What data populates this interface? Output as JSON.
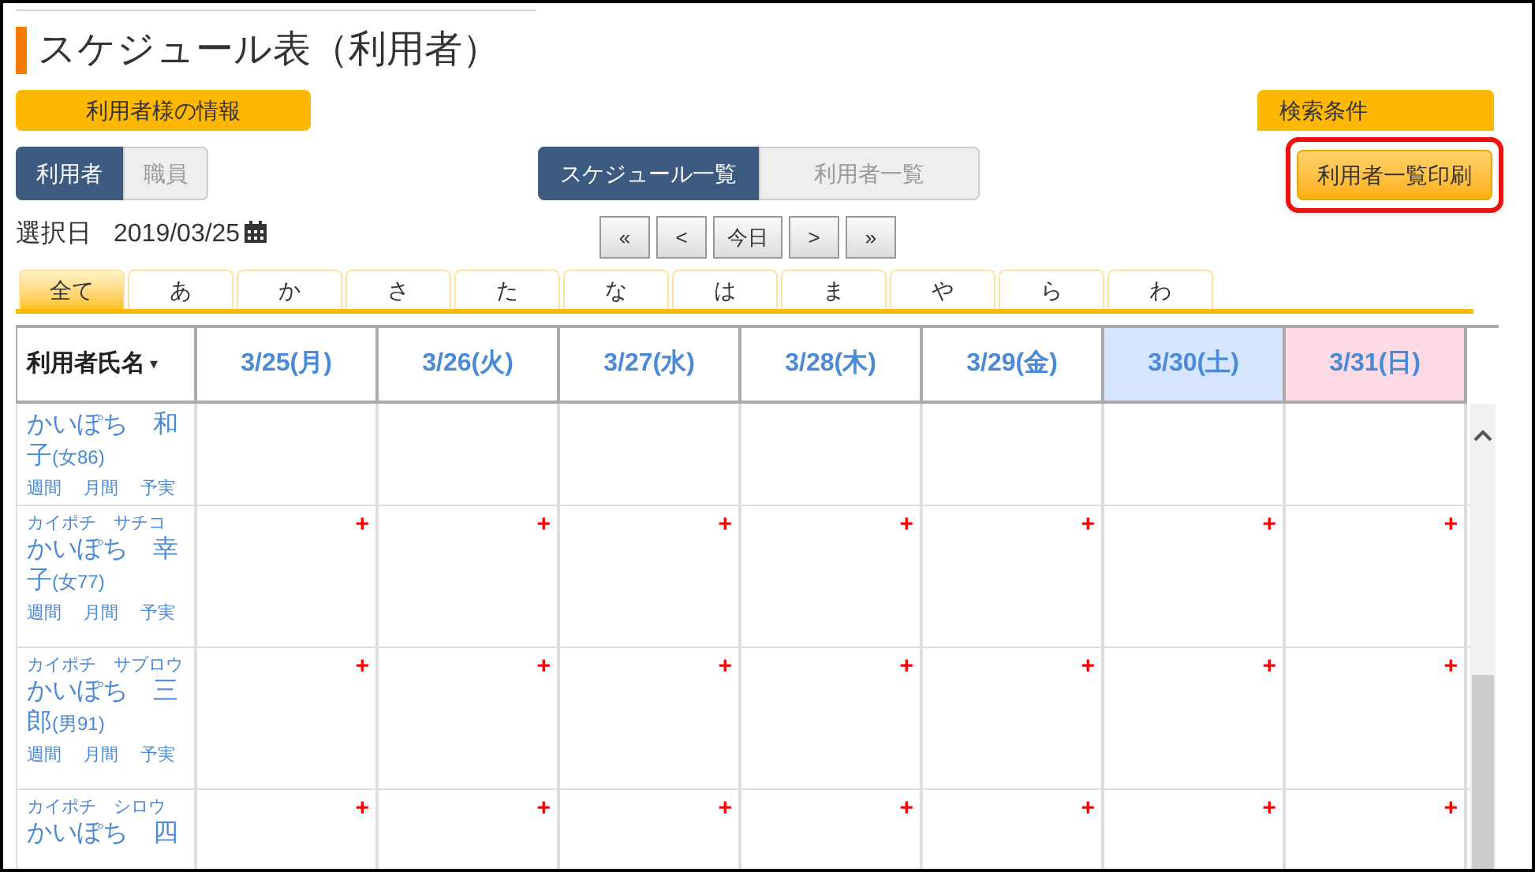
{
  "page_title": "スケジュール表（利用者）",
  "info_header": "利用者様の情報",
  "search_header": "検索条件",
  "print_button": "利用者一覧印刷",
  "target_tabs": [
    {
      "label": "利用者",
      "selected": true
    },
    {
      "label": "職員",
      "selected": false
    }
  ],
  "view_tabs": [
    {
      "label": "スケジュール一覧",
      "selected": true
    },
    {
      "label": "利用者一覧",
      "selected": false
    }
  ],
  "date_label": "選択日",
  "date_value": "2019/03/25",
  "nav_buttons": [
    "«",
    "<",
    "今日",
    ">",
    "»"
  ],
  "kana_tabs": [
    {
      "label": "全て",
      "selected": true
    },
    {
      "label": "あ",
      "selected": false
    },
    {
      "label": "か",
      "selected": false
    },
    {
      "label": "さ",
      "selected": false
    },
    {
      "label": "た",
      "selected": false
    },
    {
      "label": "な",
      "selected": false
    },
    {
      "label": "は",
      "selected": false
    },
    {
      "label": "ま",
      "selected": false
    },
    {
      "label": "や",
      "selected": false
    },
    {
      "label": "ら",
      "selected": false
    },
    {
      "label": "わ",
      "selected": false
    }
  ],
  "table": {
    "name_column": "利用者氏名",
    "sort_caret": "▾",
    "days": [
      {
        "label": "3/25(月)",
        "kind": "weekday"
      },
      {
        "label": "3/26(火)",
        "kind": "weekday"
      },
      {
        "label": "3/27(水)",
        "kind": "weekday"
      },
      {
        "label": "3/28(木)",
        "kind": "weekday"
      },
      {
        "label": "3/29(金)",
        "kind": "weekday"
      },
      {
        "label": "3/30(土)",
        "kind": "saturday"
      },
      {
        "label": "3/31(日)",
        "kind": "sunday"
      }
    ],
    "rows": [
      {
        "name": "かいぽち　和子",
        "age": "(女86)",
        "links": [
          "週間",
          "月間",
          "予実"
        ]
      },
      {
        "kana": "カイポチ　サチコ",
        "name": "かいぽち　幸子",
        "age": "(女77)",
        "links": [
          "週間",
          "月間",
          "予実"
        ],
        "cells": [
          "+",
          "+",
          "+",
          "+",
          "+",
          "+",
          "+"
        ]
      },
      {
        "kana": "カイポチ　サブロウ",
        "name": "かいぽち　三郎",
        "age": "(男91)",
        "links": [
          "週間",
          "月間",
          "予実"
        ],
        "cells": [
          "+",
          "+",
          "+",
          "+",
          "+",
          "+",
          "+"
        ]
      },
      {
        "kana": "カイポチ　シロウ",
        "name": "かいぽち　四",
        "cells": [
          "+",
          "+",
          "+",
          "+",
          "+",
          "+",
          "+"
        ]
      }
    ]
  }
}
